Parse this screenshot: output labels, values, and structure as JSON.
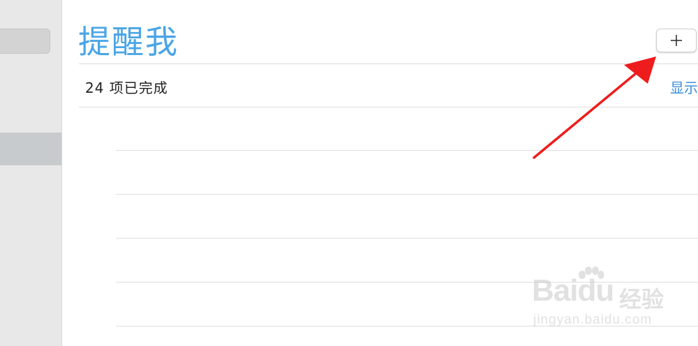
{
  "header": {
    "title": "提醒我",
    "add_button_label": "+"
  },
  "completed": {
    "count_text": "24  项已完成",
    "show_label": "显示"
  },
  "colors": {
    "title": "#4aa5e6",
    "link": "#3b8fd9",
    "annotation_arrow": "#ee1c1c"
  },
  "watermark": {
    "logo_bai": "Bai",
    "logo_du": "du",
    "logo_cn": "经验",
    "url": "jingyan.baidu.com"
  },
  "icons": {
    "add": "plus-icon",
    "annotation": "red-arrow-icon"
  }
}
